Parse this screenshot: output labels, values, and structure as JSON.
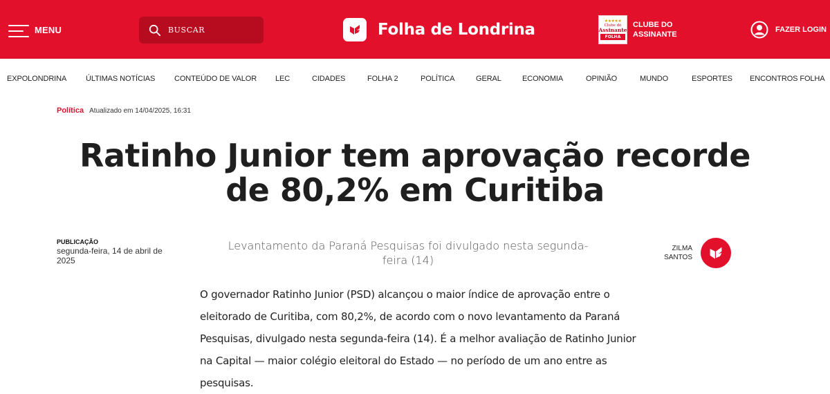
{
  "header": {
    "menu_label": "MENU",
    "search_placeholder": "BUSCAR",
    "brand_name": "Folha de Londrina",
    "club": {
      "badge_small": "Clube do",
      "badge_big": "Assinante",
      "badge_strip": "FOLHA",
      "label_line1": "CLUBE DO",
      "label_line2": "ASSINANTE"
    },
    "login_label": "FAZER LOGIN",
    "colors": {
      "brand_red": "#e3102b",
      "search_bg": "#b70c20"
    }
  },
  "nav": {
    "items": [
      "EXPOLONDRINA",
      "ÚLTIMAS NOTÍCIAS",
      "CONTEÚDO DE VALOR",
      "LEC",
      "CIDADES",
      "FOLHA 2",
      "POLÍTICA",
      "GERAL",
      "ECONOMIA",
      "OPINIÃO",
      "MUNDO",
      "ESPORTES",
      "ENCONTROS FOLHA"
    ]
  },
  "article": {
    "category": "Política",
    "updated": "Atualizado em 14/04/2025, 16:31",
    "headline_line1": "Ratinho Junior tem aprovação recorde",
    "headline_line2": "de 80,2% em Curitiba",
    "publication_label": "PUBLICAÇÃO",
    "publication_date": "segunda-feira, 14 de abril de 2025",
    "subtitle": "Levantamento da Paraná Pesquisas foi divulgado nesta segunda-feira (14)",
    "author_first": "ZILMA",
    "author_last": "SANTOS",
    "body": "O governador Ratinho Junior (PSD) alcançou o maior índice de aprovação entre o eleitorado de Curitiba, com 80,2%, de acordo com o novo levantamento da Paraná Pesquisas, divulgado nesta segunda-feira (14). É a melhor avaliação de Ratinho Junior na Capital — maior colégio eleitoral do Estado — no período de um ano entre as pesquisas."
  }
}
